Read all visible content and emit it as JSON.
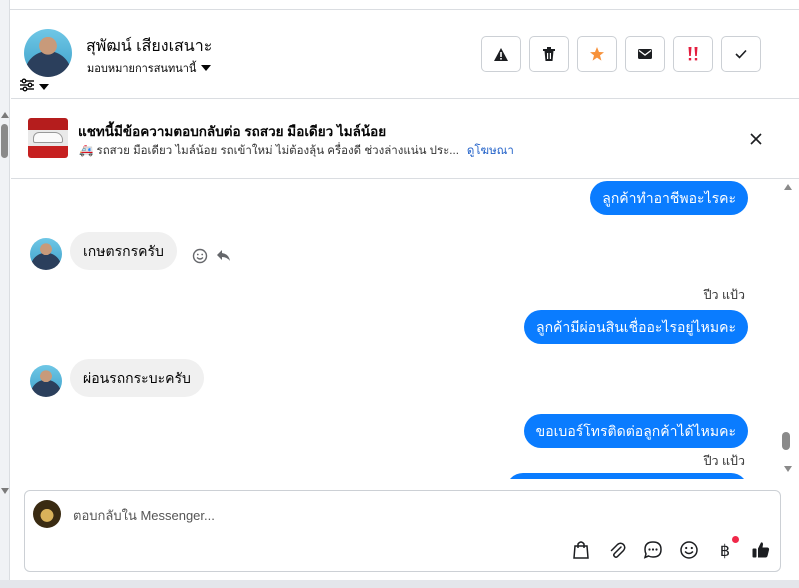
{
  "header": {
    "contact_name": "สุพัฒน์ เสียงเสนาะ",
    "assign_label": "มอบหมายการสนทนานี้",
    "actions": [
      {
        "name": "spam-button",
        "icon": "warning-icon"
      },
      {
        "name": "delete-button",
        "icon": "trash-icon"
      },
      {
        "name": "follow-up-button",
        "icon": "star-icon"
      },
      {
        "name": "mark-unread-button",
        "icon": "envelope-icon"
      },
      {
        "name": "priority-button",
        "icon": "exclamation-icon"
      },
      {
        "name": "done-button",
        "icon": "check-icon"
      }
    ]
  },
  "ad": {
    "title": "แชทนี้มีข้อความตอบกลับต่อ รถสวย มือเดียว ไมล์น้อย",
    "subtitle": "🚑 รถสวย มือเดียว ไมล์น้อย รถเข้าใหม่ ไม่ต้องลุ้น ครื่องดี ช่วงล่างแน่น ประ...",
    "link": "ดูโฆษณา"
  },
  "chat": {
    "msg_out_1": "ลูกค้าทำอาชีพอะไรคะ",
    "msg_in_1": "เกษตรกรครับ",
    "sender_1": "ปีว แป้ว",
    "msg_out_2": "ลูกค้ามีผ่อนสินเชื่ออะไรอยู่ไหมคะ",
    "msg_in_2": "ผ่อนรถกระบะครับ",
    "msg_out_3": "ขอเบอร์โทรติดต่อลูกค้าได้ไหมคะ",
    "sender_2": "ปีว แป้ว"
  },
  "composer": {
    "placeholder": "ตอบกลับใน Messenger...",
    "tools": [
      "shopping-bag-icon",
      "paperclip-icon",
      "saved-reply-icon",
      "emoji-icon",
      "baht-icon",
      "like-icon"
    ]
  },
  "colors": {
    "outgoing_bubble": "#0a7cff",
    "incoming_bubble": "#f0f0f0",
    "link": "#2463c9",
    "priority": "#e41e3f",
    "star": "#f7923b"
  }
}
